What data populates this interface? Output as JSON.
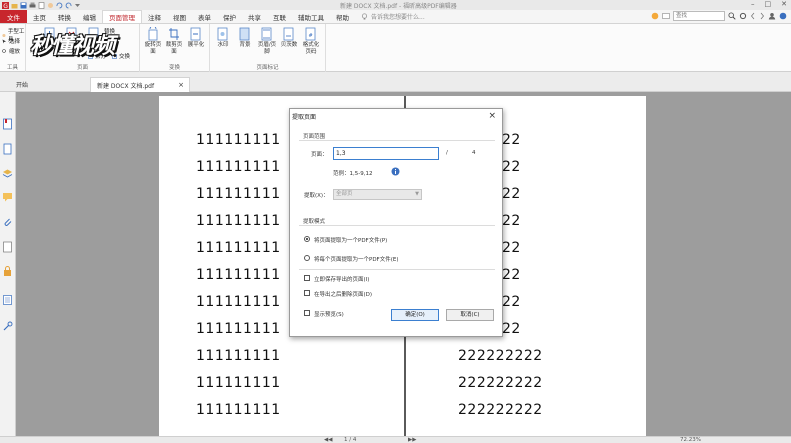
{
  "window": {
    "title": "新建 DOCX 文档.pdf - 福昕高级PDF编辑器",
    "controls": [
      "–",
      "□",
      "✕"
    ]
  },
  "menu": {
    "tabs": [
      "文件",
      "主页",
      "转换",
      "编辑",
      "页面管理",
      "注释",
      "视图",
      "表单",
      "保护",
      "共享",
      "互联",
      "辅助工具",
      "帮助"
    ],
    "active_tab": "页面管理",
    "help_search_placeholder": "告诉我您想要什么...",
    "search_placeholder": "查找"
  },
  "ribbon": {
    "tools_group": {
      "label": "工具",
      "items": [
        "手型工具",
        "选择",
        "缩放"
      ]
    },
    "pages_group": {
      "label": "页面",
      "buttons": [
        "插入",
        "删除",
        "提取",
        "替换",
        "拆分",
        "交换"
      ]
    },
    "transform_group": {
      "label": "变换",
      "buttons": [
        "旋转页面",
        "裁剪页面",
        "展平化"
      ]
    },
    "page_marks_group": {
      "label": "页面标记",
      "buttons": [
        "水印",
        "背景",
        "页眉/页脚",
        "贝茨数",
        "格式化页码"
      ]
    }
  },
  "watermark_text": "秒懂视频",
  "doc_tabs": [
    {
      "label": "开始"
    },
    {
      "label": "新建 DOCX 文档.pdf",
      "close": "×"
    }
  ],
  "document": {
    "left_page_lines": [
      "111111111",
      "111111111",
      "111111111",
      "111111111",
      "111111111",
      "111111111",
      "111111111",
      "111111111",
      "111111111",
      "111111111",
      "111111111"
    ],
    "right_page_lines": [
      "22",
      "22",
      "22",
      "22",
      "22",
      "22",
      "22",
      "22",
      "222222222",
      "222222222",
      "222222222"
    ]
  },
  "dialog": {
    "title": "提取页面",
    "close": "×",
    "range_section": "页面范围",
    "pages_label": "页面：",
    "pages_value": "1,3",
    "separator": "/",
    "total_pages": "4",
    "example": "范例：1,5-9,12",
    "extract_label": "提取(X)：",
    "extract_value": "全部页",
    "mode_section": "提取模式",
    "mode_single": "将页面提取为一个PDF文件(P)",
    "mode_each": "将每个页面提取为一个PDF文件(E)",
    "save_now": "立即保存导出的页面(I)",
    "delete_after": "在导出之后删除页面(D)",
    "show_preview": "显示预览(S)",
    "ok": "确定(O)",
    "cancel": "取消(C)"
  },
  "statusbar": {
    "page_indicator": "1 / 4",
    "zoom": "72.23%"
  },
  "colors": {
    "accent_red": "#c8262d",
    "focus_blue": "#3b7fd0",
    "doc_background": "#9d9d9d"
  }
}
